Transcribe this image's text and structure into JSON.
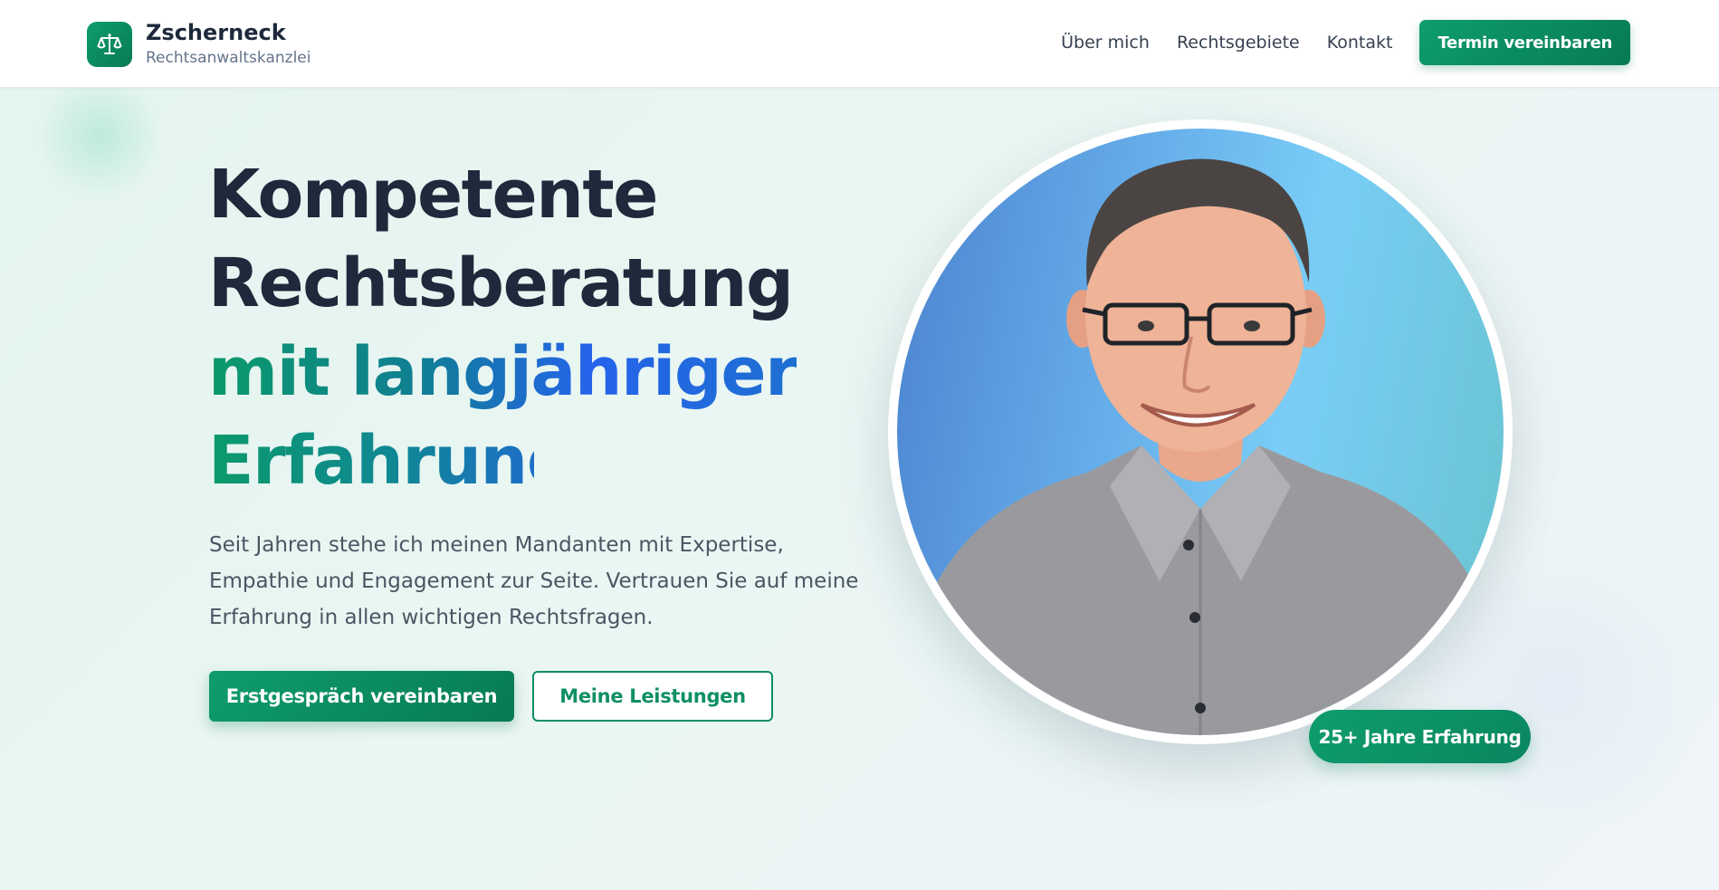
{
  "brand": {
    "name": "Zscherneck",
    "subtitle": "Rechtsanwaltskanzlei",
    "logo_icon": "scales-icon"
  },
  "nav": {
    "items": [
      {
        "label": "Über mich"
      },
      {
        "label": "Rechtsgebiete"
      },
      {
        "label": "Kontakt"
      }
    ],
    "cta_label": "Termin vereinbaren"
  },
  "hero": {
    "title_line1": "Kompetente",
    "title_line2": "Rechtsberatung",
    "title_line3": "mit langjähriger",
    "title_line4": "Erfahrung",
    "description": "Seit Jahren stehe ich meinen Mandanten mit Expertise, Empathie und Engagement zur Seite. Vertrauen Sie auf meine Erfahrung in allen wichtigen Rechtsfragen.",
    "primary_button": "Erstgespräch vereinbaren",
    "secondary_button": "Meine Leistungen",
    "experience_badge": "25+ Jahre Erfahrung"
  },
  "colors": {
    "accent": "#0f9d6b",
    "accent_dark": "#067a55",
    "heading": "#1e293b",
    "body_text": "#4b5563",
    "gradient_blue": "#2563eb"
  }
}
